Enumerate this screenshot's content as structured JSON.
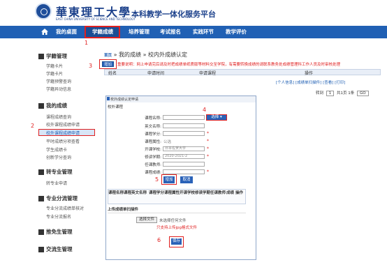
{
  "header": {
    "logo_text": "華東理工大學",
    "logo_en": "EAST CHINA UNIVERSITY OF SCIENCE AND TECHNOLOGY",
    "site_title": "本科教学一体化服务平台"
  },
  "nav": {
    "items": [
      "我的桌面",
      "学籍成绩",
      "培养管理",
      "考试报名",
      "实践环节",
      "教学评价"
    ],
    "active": "学籍成绩"
  },
  "sidebar": {
    "groups": [
      {
        "title": "学籍管理",
        "items": [
          "学籍卡片",
          "学籍卡片",
          "学籍预警查询",
          "学籍异动信息"
        ]
      },
      {
        "title": "我的成绩",
        "items": [
          "课程成绩查询",
          "校外课程成绩申请",
          "校外课程成绩申请",
          "平时成绩分项查看",
          "学生成绩卡",
          "创新学分查询"
        ]
      },
      {
        "title": "转专业管理",
        "items": [
          "转专业申请"
        ]
      },
      {
        "title": "专业分流管理",
        "items": [
          "专业分流成绩单核对",
          "专业分流报名"
        ]
      },
      {
        "title": "推免生管理",
        "items": []
      },
      {
        "title": "交流生管理",
        "items": []
      }
    ],
    "active_item": "校外课程成绩申请"
  },
  "main": {
    "breadcrumb_home": "首页",
    "breadcrumb_sep": "»",
    "breadcrumb_1": "我的成绩",
    "breadcrumb_2": "校内外成绩认定",
    "add_label": "增加",
    "notice": "重要说明：网上申请完后请及时把成绩单纸质版等材料交至学院，有需要转换成绩的请联系教务处成绩管理科工作人员及时审核处理",
    "table_headers": [
      "姓名",
      "申请时间",
      "申请课程",
      "操作"
    ],
    "row_actions": "[个人信息] [成绩单扫描件] [查看] [打印]",
    "pager_prefix": "转到",
    "pager_page": "1",
    "pager_mid": "共1页 1条",
    "pager_go": "GO"
  },
  "dialog": {
    "title": "校外成绩认定申请",
    "section": "校外课程",
    "fields": [
      {
        "label": "课程名称:",
        "value": ""
      },
      {
        "label": "英文名称:",
        "value": ""
      },
      {
        "label": "课程学分:",
        "value": ""
      },
      {
        "label": "课程属性:",
        "value": "公选"
      },
      {
        "label": "开课学校:",
        "value": "日本佐贺大学"
      },
      {
        "label": "修读学期:",
        "value": "2020-2021-2"
      },
      {
        "label": "任课教师:",
        "value": ""
      },
      {
        "label": "课程成绩:",
        "value": ""
      }
    ],
    "select_label": "选择",
    "add_label": "增加",
    "cancel_label": "取消",
    "table_headers": [
      "课程名称",
      "课程英文名称",
      "课程学分",
      "课程属性",
      "开课学校",
      "修读学期",
      "任课教师",
      "成绩",
      "操作"
    ],
    "upload_label": "上传成绩单扫描件",
    "choose_file_label": "选择文件",
    "no_file_label": "未选择任何文件",
    "format_hint": "只支持上传jpg格式文件",
    "save_label": "保存"
  },
  "steps": [
    "1",
    "2",
    "3",
    "4",
    "5",
    "6"
  ],
  "colors": {
    "nav": "#2060b4",
    "accent": "#2a62b8",
    "annotation": "#e02020"
  }
}
